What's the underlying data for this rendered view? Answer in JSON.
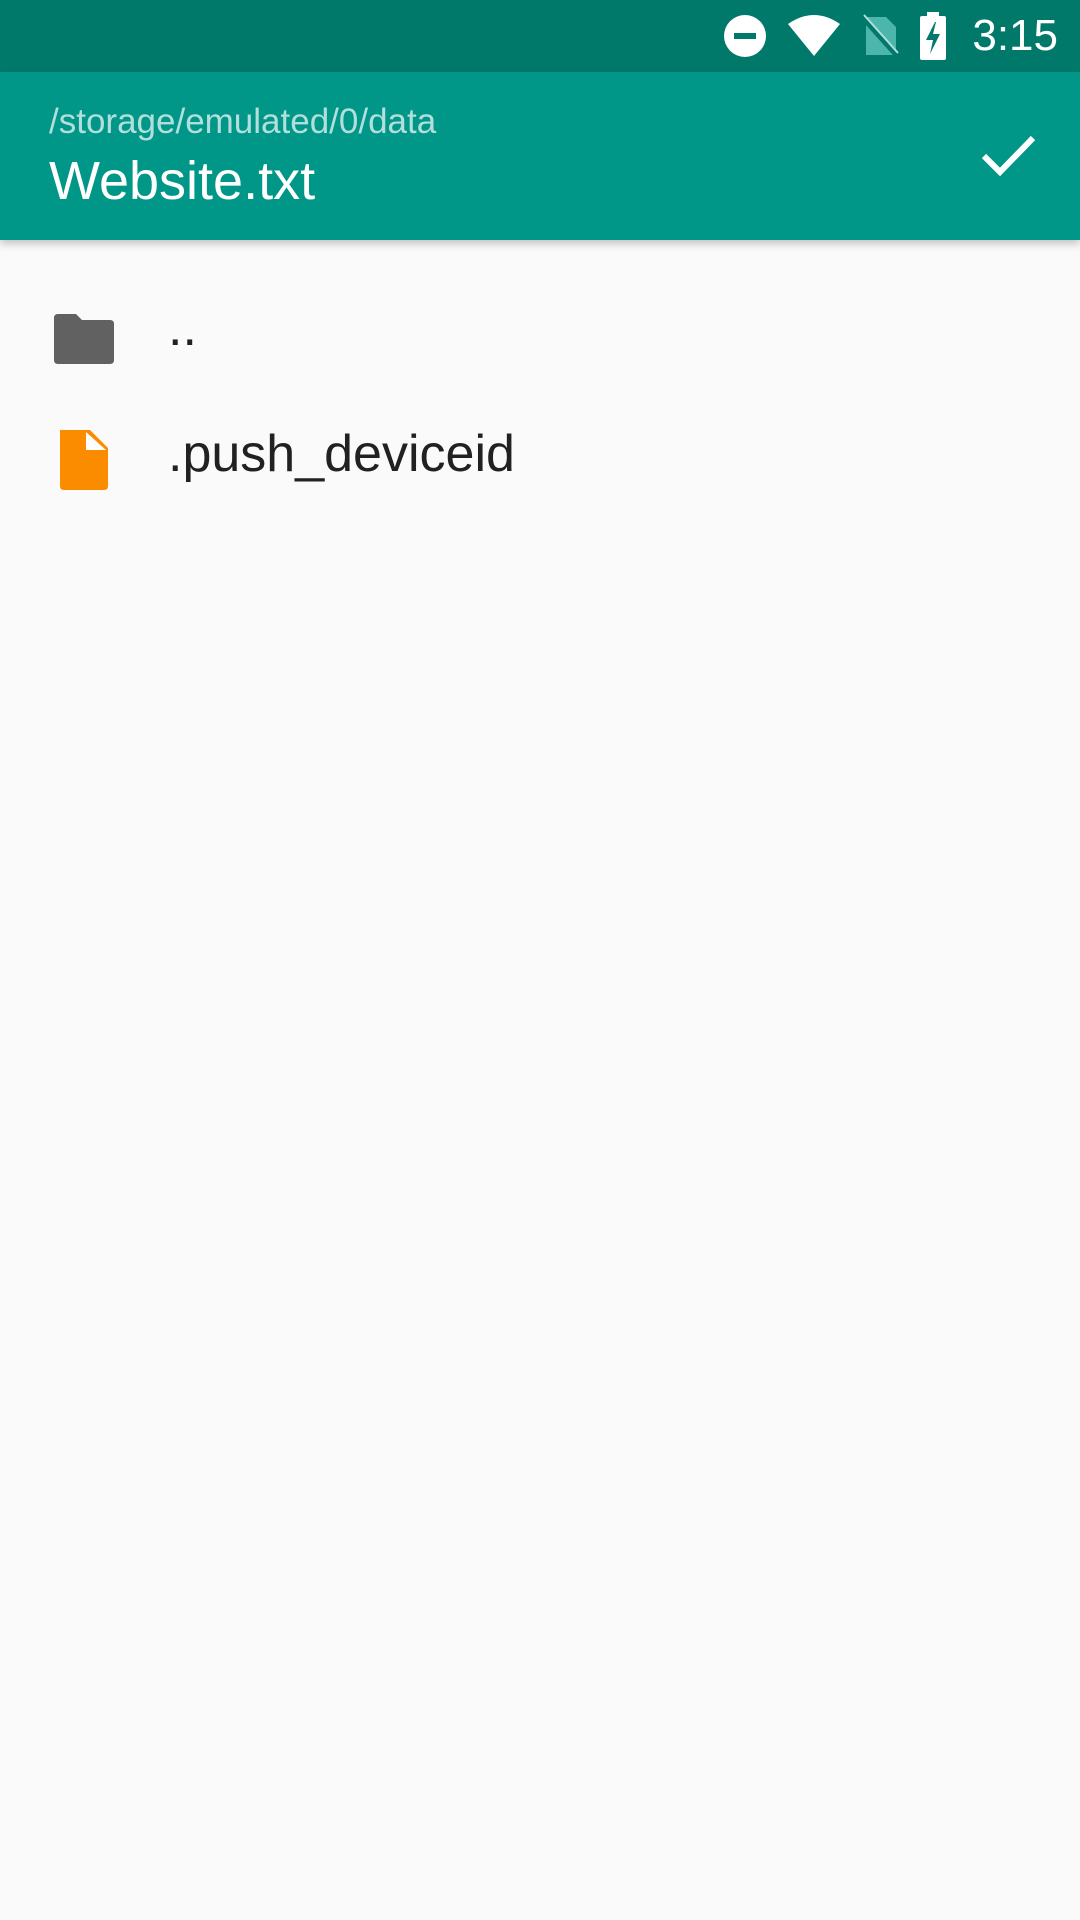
{
  "status_bar": {
    "time": "3:15",
    "icons": [
      "do-not-disturb-icon",
      "wifi-icon",
      "no-sim-icon",
      "battery-charging-icon"
    ]
  },
  "app_bar": {
    "path": "/storage/emulated/0/data",
    "title": "Website.txt",
    "confirm_icon": "check-icon",
    "background_color": "#009688"
  },
  "file_list": {
    "items": [
      {
        "label": "..",
        "icon": "folder-icon",
        "icon_color": "#616161"
      },
      {
        "label": ".push_deviceid",
        "icon": "file-icon",
        "icon_color": "#fb8c00"
      }
    ]
  }
}
